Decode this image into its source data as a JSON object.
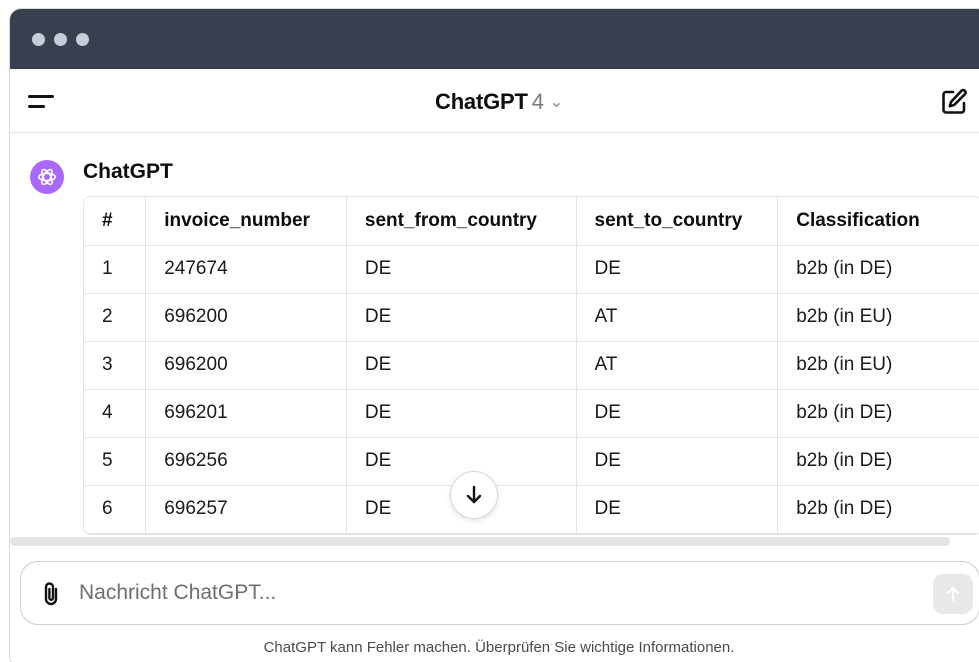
{
  "window": {
    "controls": [
      "close",
      "minimize",
      "zoom"
    ]
  },
  "header": {
    "model_name": "ChatGPT",
    "model_version": "4",
    "icons": {
      "menu": "sidebar-toggle-icon",
      "edit": "new-chat-icon",
      "chevron": "chevron-down-icon"
    }
  },
  "message": {
    "sender": "ChatGPT",
    "avatar_color": "#ab68ff",
    "table": {
      "headers": [
        "#",
        "invoice_number",
        "sent_from_country",
        "sent_to_country",
        "Classification"
      ],
      "rows": [
        [
          "1",
          "247674",
          "DE",
          "DE",
          "b2b (in DE)"
        ],
        [
          "2",
          "696200",
          "DE",
          "AT",
          "b2b (in EU)"
        ],
        [
          "3",
          "696200",
          "DE",
          "AT",
          "b2b (in EU)"
        ],
        [
          "4",
          "696201",
          "DE",
          "DE",
          "b2b (in DE)"
        ],
        [
          "5",
          "696256",
          "DE",
          "DE",
          "b2b (in DE)"
        ],
        [
          "6",
          "696257",
          "DE",
          "DE",
          "b2b (in DE)"
        ]
      ]
    }
  },
  "composer": {
    "placeholder": "Nachricht ChatGPT...",
    "value": "",
    "icons": {
      "attach": "paperclip-icon",
      "send": "arrow-up-icon",
      "scroll": "arrow-down-icon"
    }
  },
  "footer": {
    "disclaimer": "ChatGPT kann Fehler machen. Überprüfen Sie wichtige Informationen."
  },
  "colors": {
    "titlebar": "#384050",
    "avatar": "#ab68ff",
    "send_disabled": "#e8e8e8"
  }
}
